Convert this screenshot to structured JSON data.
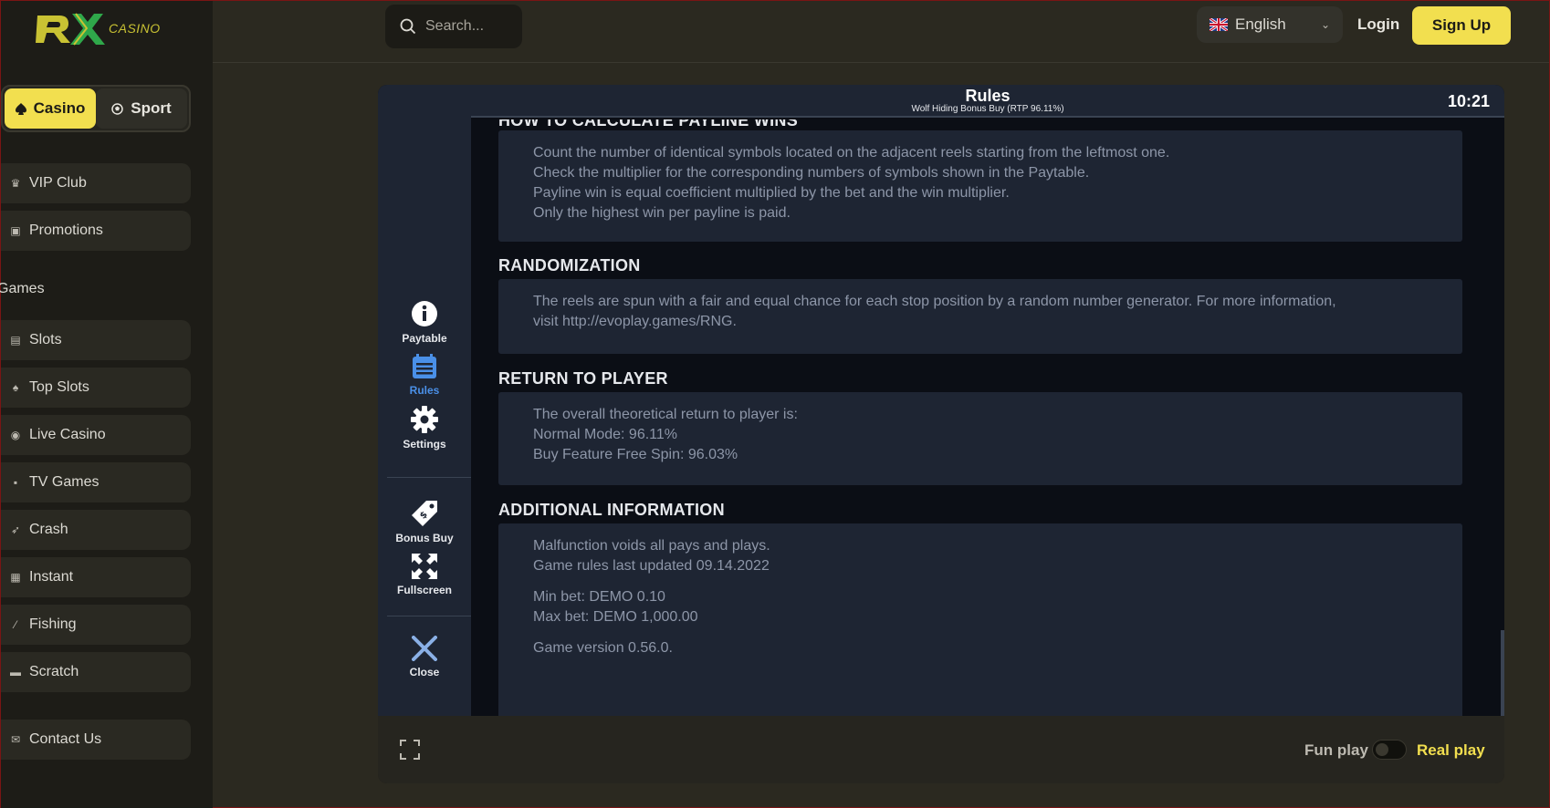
{
  "brand": {
    "logo_casino": "CASINO"
  },
  "sidebar": {
    "mode": {
      "casino": "Casino",
      "sport": "Sport"
    },
    "top_items": [
      {
        "label": "VIP Club",
        "icon": "crown-icon"
      },
      {
        "label": "Promotions",
        "icon": "gift-icon"
      }
    ],
    "games_label": "Games",
    "game_items": [
      {
        "label": "Slots",
        "icon": "slot-machine-icon"
      },
      {
        "label": "Top Slots",
        "icon": "top-slots-icon"
      },
      {
        "label": "Live Casino",
        "icon": "live-casino-icon"
      },
      {
        "label": "TV Games",
        "icon": "tv-icon"
      },
      {
        "label": "Crash",
        "icon": "rocket-icon"
      },
      {
        "label": "Instant",
        "icon": "grid-icon"
      },
      {
        "label": "Fishing",
        "icon": "fishing-rod-icon"
      },
      {
        "label": "Scratch",
        "icon": "ticket-icon"
      }
    ],
    "contact": {
      "label": "Contact Us",
      "icon": "chat-icon"
    }
  },
  "header": {
    "search_placeholder": "Search...",
    "language": "English",
    "login": "Login",
    "signup": "Sign Up"
  },
  "game": {
    "title": "Rules",
    "subtitle": "Wolf Hiding Bonus Buy (RTP 96.11%)",
    "time": "10:21",
    "side_buttons": {
      "paytable": "Paytable",
      "rules": "Rules",
      "settings": "Settings",
      "bonus_buy": "Bonus Buy",
      "fullscreen": "Fullscreen",
      "close": "Close"
    },
    "sections": {
      "payline": {
        "title": "HOW TO CALCULATE PAYLINE WINS",
        "lines": [
          "Count the number of identical symbols located on the adjacent reels starting from the leftmost one.",
          "Check the multiplier for the corresponding numbers of symbols shown in the Paytable.",
          "Payline win is equal coefficient multiplied by the bet and the win multiplier.",
          "Only the highest win per payline is paid."
        ]
      },
      "randomization": {
        "title": "RANDOMIZATION",
        "lines": [
          "The reels are spun with a fair and equal chance for each stop position by a random number generator. For more information,",
          "visit http://evoplay.games/RNG."
        ]
      },
      "rtp": {
        "title": "RETURN TO PLAYER",
        "lines": [
          "The overall theoretical return to player is:",
          "Normal Mode: 96.11%",
          "Buy Feature Free Spin: 96.03%"
        ]
      },
      "additional": {
        "title": "ADDITIONAL INFORMATION",
        "lines": [
          "Malfunction voids all pays and plays.",
          "Game rules last updated 09.14.2022",
          "Min bet: DEMO 0.10",
          "Max bet: DEMO 1,000.00",
          "Game version 0.56.0."
        ]
      }
    },
    "footer": {
      "fun_play": "Fun play",
      "real_play": "Real play"
    }
  },
  "colors": {
    "accent_yellow": "#f2df4f",
    "sidebar_bg": "#1d1c17",
    "page_bg": "#2b2920",
    "game_panel": "#1e2533",
    "rules_active_blue": "#4a90e8"
  }
}
